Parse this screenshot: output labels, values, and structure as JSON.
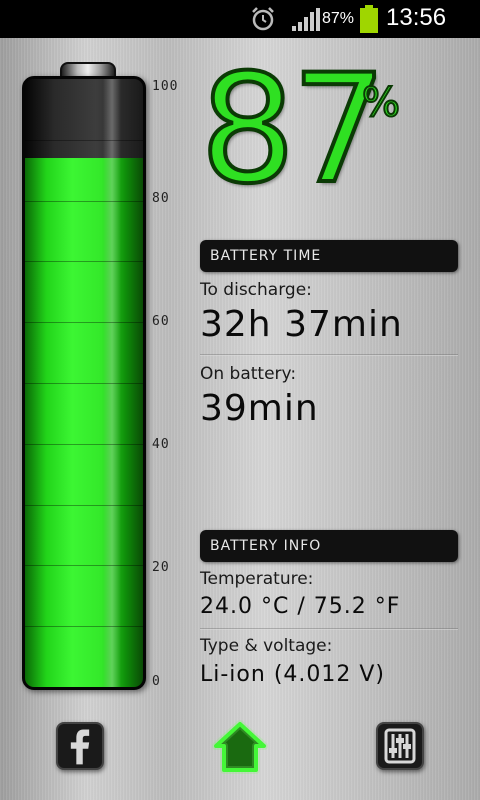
{
  "status_bar": {
    "battery_percent": "87%",
    "time": "13:56",
    "icons": [
      "alarm-icon",
      "signal-icon",
      "battery-icon"
    ]
  },
  "battery": {
    "level": 87,
    "scale": [
      "100",
      "80",
      "60",
      "40",
      "20",
      "0"
    ],
    "percent_number": "87",
    "percent_sign": "%"
  },
  "battery_time": {
    "header": "BATTERY TIME",
    "discharge_label": "To discharge:",
    "discharge_value": "32h 37min",
    "on_battery_label": "On battery:",
    "on_battery_value": "39min"
  },
  "battery_info": {
    "header": "BATTERY INFO",
    "temperature_label": "Temperature:",
    "temperature_value": "24.0 °C / 75.2 °F",
    "type_label": "Type & voltage:",
    "type_value": "Li-ion (4.012 V)"
  },
  "bottom_nav": {
    "icons": [
      "facebook-icon",
      "home-icon",
      "settings-sliders-icon"
    ]
  },
  "colors": {
    "accent_green": "#2fe022",
    "header_bg": "#111111"
  }
}
